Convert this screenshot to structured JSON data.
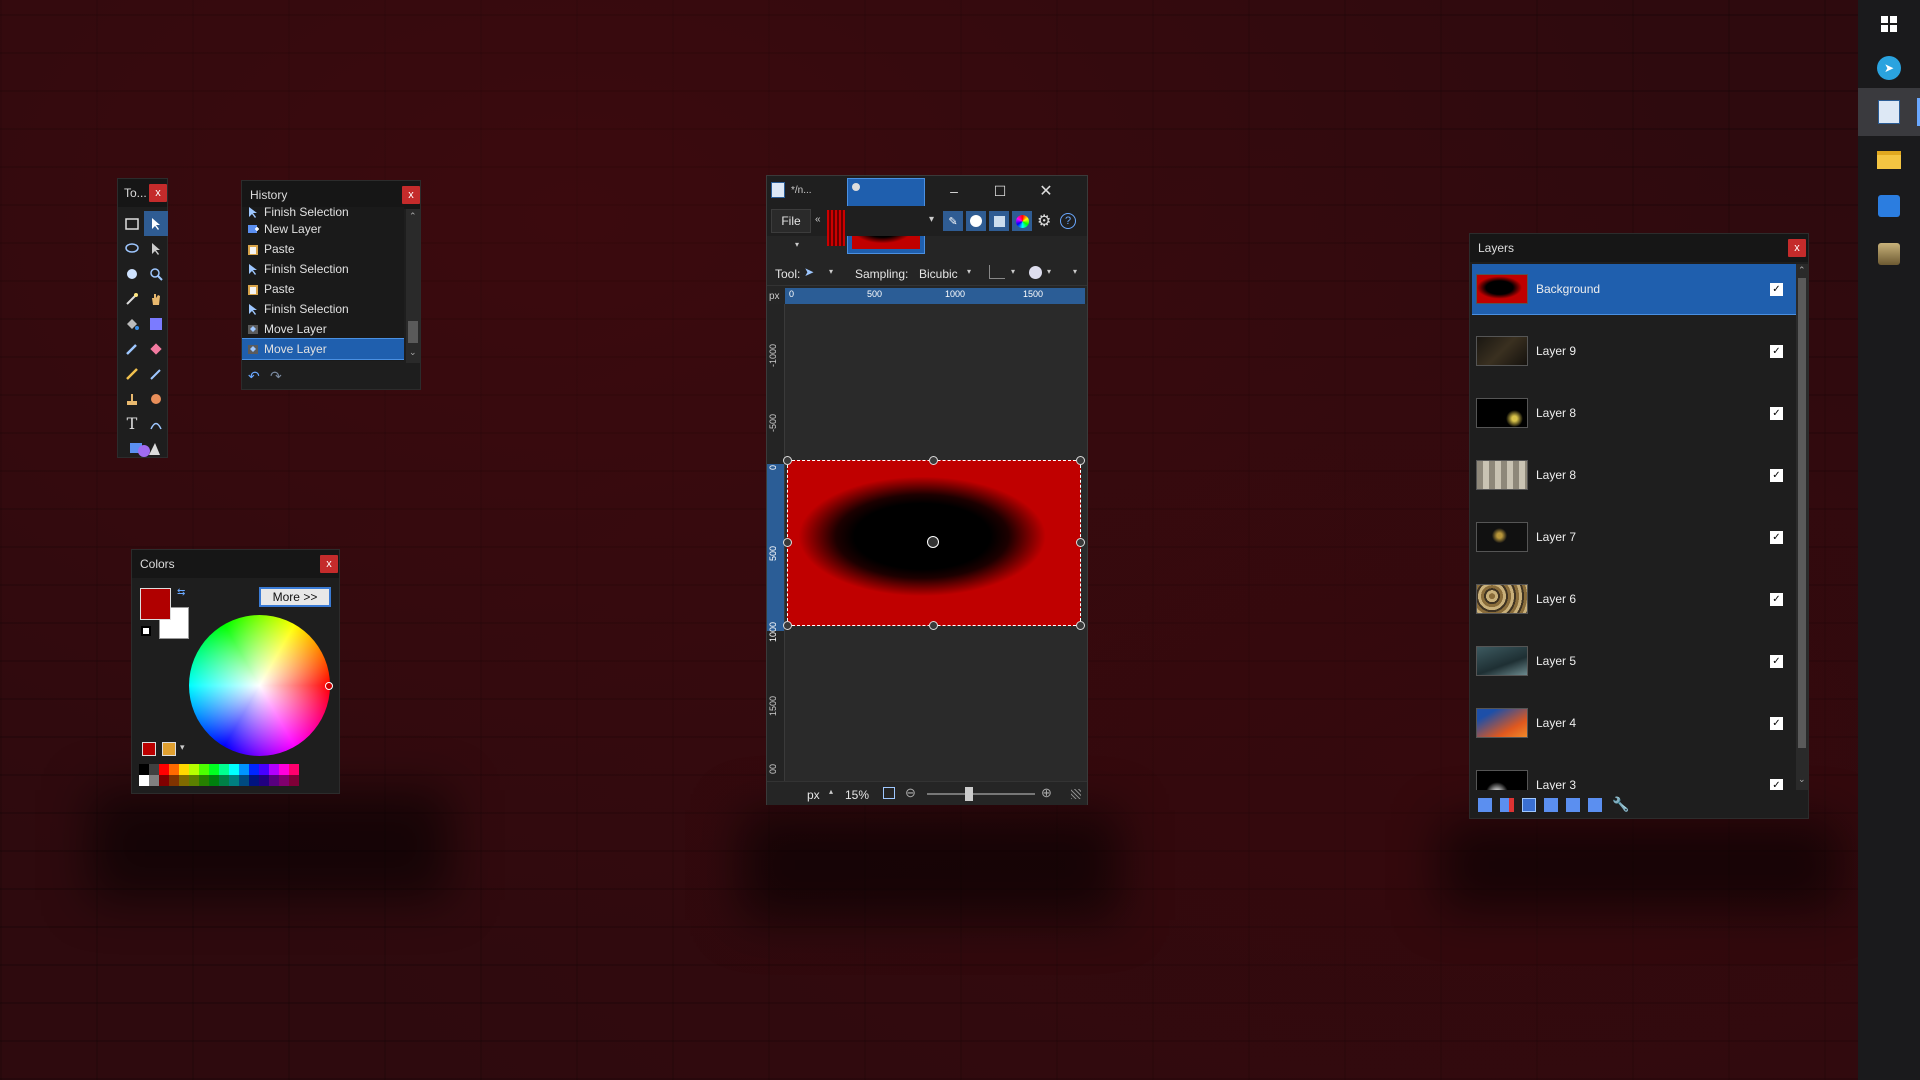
{
  "tools_panel": {
    "title": "To...",
    "close": "x"
  },
  "history_panel": {
    "title": "History",
    "close": "x",
    "items": [
      "Finish Selection",
      "New Layer",
      "Paste",
      "Finish Selection",
      "Paste",
      "Finish Selection",
      "Move Layer",
      "Move Layer"
    ]
  },
  "colors_panel": {
    "title": "Colors",
    "close": "x",
    "more_button": "More >>",
    "primary_color": "#b00000",
    "secondary_color": "#ffffff"
  },
  "main_window": {
    "title": "*/n...",
    "menu_file": "File",
    "tool_label": "Tool:",
    "sampling_label": "Sampling:",
    "sampling_value": "Bicubic",
    "ruler_unit": "px",
    "ruler_h_ticks": [
      "0",
      "500",
      "1000",
      "1500"
    ],
    "ruler_v_ticks": [
      "-1000",
      "-500",
      "0",
      "500",
      "1000",
      "1500",
      "00"
    ],
    "status_unit": "px",
    "zoom": "15%",
    "zoom_slider_fraction": 0.35
  },
  "layers_panel": {
    "title": "Layers",
    "close": "x",
    "layers": [
      {
        "name": "Background",
        "visible": "✓"
      },
      {
        "name": "Layer 9",
        "visible": "✓"
      },
      {
        "name": "Layer 8",
        "visible": "✓"
      },
      {
        "name": "Layer 8",
        "visible": "✓"
      },
      {
        "name": "Layer 7",
        "visible": "✓"
      },
      {
        "name": "Layer 6",
        "visible": "✓"
      },
      {
        "name": "Layer 5",
        "visible": "✓"
      },
      {
        "name": "Layer 4",
        "visible": "✓"
      },
      {
        "name": "Layer 3",
        "visible": "✓"
      }
    ]
  },
  "taskbar": {
    "icons": [
      "windows-start-icon",
      "telegram-icon",
      "paint-net-icon",
      "file-explorer-icon",
      "mail-icon",
      "app-icon"
    ]
  }
}
